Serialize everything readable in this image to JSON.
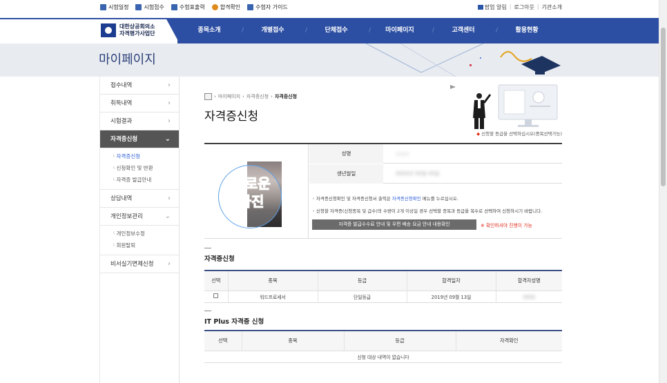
{
  "utility": {
    "left": [
      {
        "label": "시험일정",
        "icon": "calendar-icon"
      },
      {
        "label": "시험접수",
        "icon": "edit-icon"
      },
      {
        "label": "수험표출력",
        "icon": "print-icon"
      },
      {
        "label": "합격확인",
        "icon": "user-check-icon"
      },
      {
        "label": "수험자 가이드",
        "icon": "book-icon"
      }
    ],
    "right": {
      "popup": "팝업 알림",
      "logout": "로그아웃",
      "intro": "기관소개"
    }
  },
  "logo": {
    "line1": "대한상공회의소",
    "line2": "자격평가사업단"
  },
  "nav": [
    "종목소개",
    "개별접수",
    "단체접수",
    "마이페이지",
    "고객센터",
    "활용현황"
  ],
  "banner": {
    "title": "마이페이지"
  },
  "sidebar": {
    "items": [
      {
        "label": "접수내역"
      },
      {
        "label": "취득내역"
      },
      {
        "label": "시험결과"
      },
      {
        "label": "자격증신청"
      },
      {
        "label": "상담내역"
      },
      {
        "label": "개인정보관리"
      },
      {
        "label": "비서실기면제신청"
      }
    ],
    "sub_cert": [
      "자격증신청",
      "신청확인 및 반환",
      "자격증 발급안내"
    ],
    "sub_info": [
      "개인정보수정",
      "회원탈퇴"
    ]
  },
  "breadcrumb": {
    "mid1": "마이페이지",
    "mid2": "자격증신청",
    "current": "자격증신청"
  },
  "page_title": "자격증신청",
  "notice": "신청할 등급을 선택하십시오(중복선택가능)",
  "profile": {
    "photo_text_1": "새로운",
    "photo_text_2": "사진",
    "name_label": "성명",
    "name_value": "○○○",
    "birth_label": "생년월일",
    "birth_value": "0000년 00월 00일",
    "info1_a": "자격증신청확인 및 자격증신청서 출력은 ",
    "info1_link": "자격증신청확인",
    "info1_b": " 메뉴를 누르십시오.",
    "info2": "신청할 자격증(신청종목 및 급수)의 수량이 2개 이상일 경우 선택할 종목과 등급을 복수로 선택하여 신청하시기 바랍니다.",
    "fee_button": "자격증 발급수수료 안내 및 우편 배송 요금 안내 내용확인",
    "fee_warning": "※ 확인하셔야 진행이 가능"
  },
  "cert_table": {
    "title": "자격증신청",
    "headers": [
      "선택",
      "종목",
      "등급",
      "합격일자",
      "합격자성명"
    ],
    "rows": [
      {
        "item": "워드프로세서",
        "grade": "단일등급",
        "date": "2019년 09월 13일",
        "name": "○○○"
      }
    ]
  },
  "itplus_table": {
    "title": "IT Plus 자격증 신청",
    "headers": [
      "선택",
      "종목",
      "등급",
      "자격확인"
    ],
    "empty": "신청 대상 내역이 없습니다"
  }
}
